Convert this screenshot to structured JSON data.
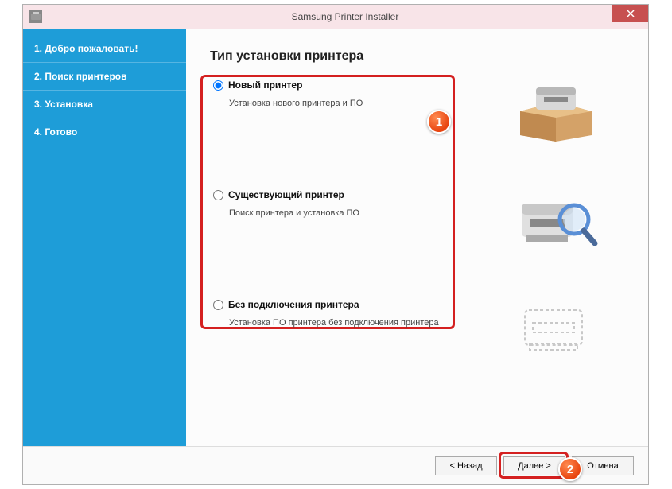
{
  "titlebar": {
    "title": "Samsung Printer Installer"
  },
  "sidebar": {
    "items": [
      {
        "label": "1. Добро пожаловать!"
      },
      {
        "label": "2. Поиск принтеров"
      },
      {
        "label": "3. Установка"
      },
      {
        "label": "4. Готово"
      }
    ]
  },
  "main": {
    "page_title": "Тип установки принтера",
    "options": [
      {
        "label": "Новый принтер",
        "desc": "Установка нового принтера и ПО",
        "selected": true
      },
      {
        "label": "Существующий принтер",
        "desc": "Поиск принтера и установка ПО",
        "selected": false
      },
      {
        "label": "Без подключения принтера",
        "desc": "Установка ПО принтера без подключения принтера",
        "selected": false
      }
    ]
  },
  "footer": {
    "back": "< Назад",
    "next": "Далее >",
    "cancel": "Отмена"
  },
  "badges": {
    "one": "1",
    "two": "2"
  }
}
